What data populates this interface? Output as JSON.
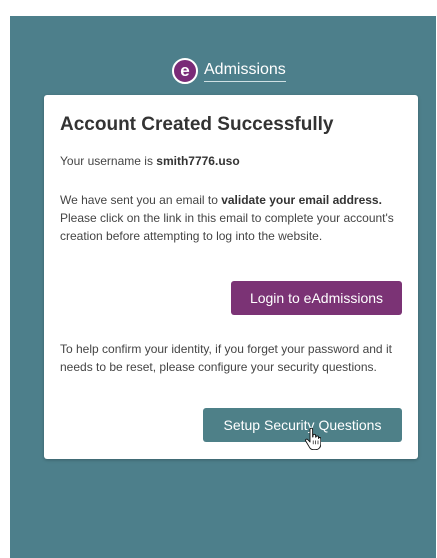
{
  "logo": {
    "mark": "e",
    "text": "Admissions"
  },
  "card": {
    "title": "Account Created Successfully",
    "username_prefix": "Your username is ",
    "username": "smith7776.uso",
    "email_text_1": "We have sent you an email to ",
    "email_bold": "validate your email address.",
    "email_text_2": " Please click on the link in this email to complete your account's creation before attempting to log into the website.",
    "login_button": "Login to eAdmissions",
    "identity_text": "To help confirm your identity, if you forget your password and it needs to be reset, please configure your security questions.",
    "security_button": "Setup Security Questions"
  },
  "colors": {
    "background": "#4d7f8b",
    "brand_purple": "#7b3375",
    "teal_button": "#4e8088"
  }
}
